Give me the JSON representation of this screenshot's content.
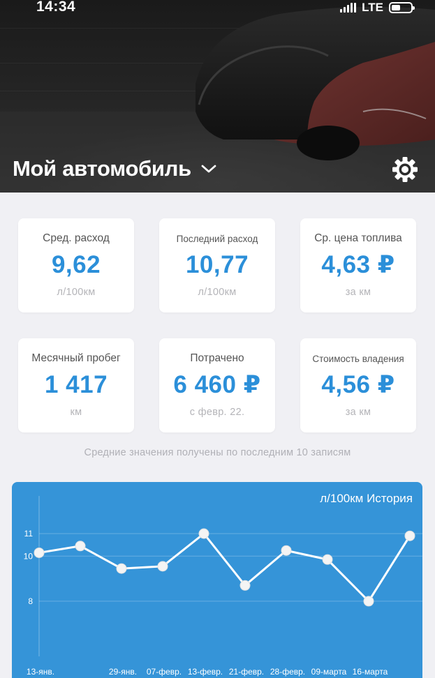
{
  "status_bar": {
    "time": "14:34",
    "network": "LTE"
  },
  "header": {
    "car_name": "Мой автомобиль"
  },
  "stats": [
    {
      "title": "Сред. расход",
      "value": "9,62",
      "unit": "л/100км"
    },
    {
      "title": "Последний расход",
      "value": "10,77",
      "unit": "л/100км"
    },
    {
      "title": "Ср. цена топлива",
      "value": "4,63 ₽",
      "unit": "за км"
    },
    {
      "title": "Месячный пробег",
      "value": "1 417",
      "unit": "км"
    },
    {
      "title": "Потрачено",
      "value": "6 460 ₽",
      "unit": "с февр. 22."
    },
    {
      "title": "Стоимость владения",
      "value": "4,56 ₽",
      "unit": "за км"
    }
  ],
  "footnote": "Средние значения получены по последним 10 записям",
  "chart_data": {
    "type": "line",
    "title": "л/100км История",
    "categories": [
      "13-янв.",
      "",
      "29-янв.",
      "07-февр.",
      "13-февр.",
      "21-февр.",
      "28-февр.",
      "09-марта",
      "16-марта",
      ""
    ],
    "values": [
      10.15,
      10.45,
      9.45,
      9.55,
      11.0,
      8.7,
      10.25,
      9.85,
      8.0,
      10.9
    ],
    "yticks": [
      8,
      10,
      11
    ],
    "ylim": [
      7.4,
      11.9
    ],
    "line_color": "#ffffff",
    "background": "#3594d8"
  }
}
